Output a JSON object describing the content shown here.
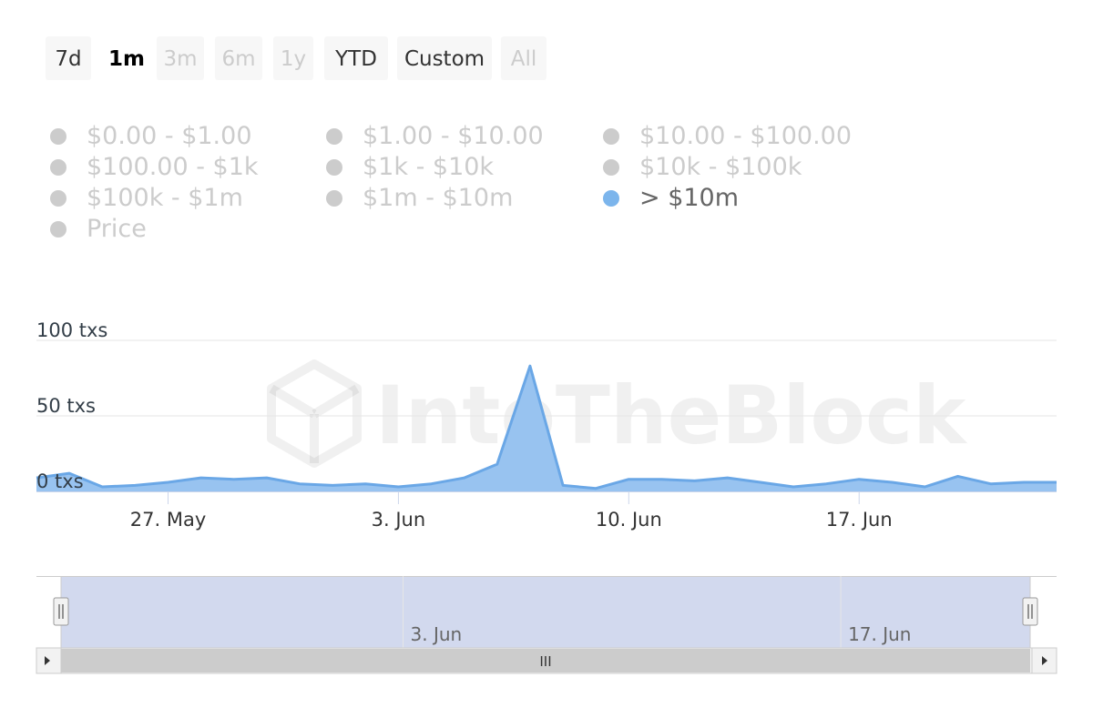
{
  "range_selector": {
    "buttons": [
      {
        "label": "7d",
        "state": "normal"
      },
      {
        "label": "1m",
        "state": "active"
      },
      {
        "label": "3m",
        "state": "disabled"
      },
      {
        "label": "6m",
        "state": "disabled"
      },
      {
        "label": "1y",
        "state": "disabled"
      },
      {
        "label": "YTD",
        "state": "normal"
      },
      {
        "label": "Custom",
        "state": "normal"
      },
      {
        "label": "All",
        "state": "disabled"
      }
    ]
  },
  "legend": {
    "items": [
      {
        "label": "$0.00 - $1.00",
        "active": false
      },
      {
        "label": "$1.00 - $10.00",
        "active": false
      },
      {
        "label": "$10.00 - $100.00",
        "active": false
      },
      {
        "label": "$100.00 - $1k",
        "active": false
      },
      {
        "label": "$1k - $10k",
        "active": false
      },
      {
        "label": "$10k - $100k",
        "active": false
      },
      {
        "label": "$100k - $1m",
        "active": false
      },
      {
        "label": "$1m - $10m",
        "active": false
      },
      {
        "label": "> $10m",
        "active": true
      },
      {
        "label": "Price",
        "active": false
      }
    ],
    "inactive_color": "#cccccc",
    "active_color": "#7cb5ec",
    "active_text_color": "#666666"
  },
  "watermark": {
    "text": "IntoTheBlock"
  },
  "colors": {
    "series_line": "#6aa7e6",
    "series_fill": "#98c3f0",
    "navigator_mask": "#d2d9ee",
    "grid": "#e6e6e6"
  },
  "chart_data": {
    "type": "area",
    "title": "",
    "xlabel": "",
    "ylabel": "",
    "ylim": [
      0,
      100
    ],
    "y_ticks": [
      {
        "value": 0,
        "label": "0 txs"
      },
      {
        "value": 50,
        "label": "50 txs"
      },
      {
        "value": 100,
        "label": "100 txs"
      }
    ],
    "x_ticks": [
      {
        "date": "2024-05-27",
        "label": "27. May"
      },
      {
        "date": "2024-06-03",
        "label": "3. Jun"
      },
      {
        "date": "2024-06-10",
        "label": "10. Jun"
      },
      {
        "date": "2024-06-17",
        "label": "17. Jun"
      }
    ],
    "x_range": [
      "2024-05-23",
      "2024-06-23"
    ],
    "series": [
      {
        "name": "> $10m",
        "x": [
          "2024-05-23",
          "2024-05-24",
          "2024-05-25",
          "2024-05-26",
          "2024-05-27",
          "2024-05-28",
          "2024-05-29",
          "2024-05-30",
          "2024-05-31",
          "2024-06-01",
          "2024-06-02",
          "2024-06-03",
          "2024-06-04",
          "2024-06-05",
          "2024-06-06",
          "2024-06-07",
          "2024-06-08",
          "2024-06-09",
          "2024-06-10",
          "2024-06-11",
          "2024-06-12",
          "2024-06-13",
          "2024-06-14",
          "2024-06-15",
          "2024-06-16",
          "2024-06-17",
          "2024-06-18",
          "2024-06-19",
          "2024-06-20",
          "2024-06-21",
          "2024-06-22",
          "2024-06-23"
        ],
        "values": [
          9,
          12,
          3,
          4,
          6,
          9,
          8,
          9,
          5,
          4,
          5,
          3,
          5,
          9,
          18,
          83,
          4,
          2,
          8,
          8,
          7,
          9,
          6,
          3,
          5,
          8,
          6,
          3,
          10,
          5,
          6,
          6
        ]
      }
    ],
    "navigator": {
      "x_ticks": [
        {
          "date": "2024-06-03",
          "label": "3. Jun"
        },
        {
          "date": "2024-06-17",
          "label": "17. Jun"
        }
      ],
      "scrollbar_grip": "III"
    }
  }
}
